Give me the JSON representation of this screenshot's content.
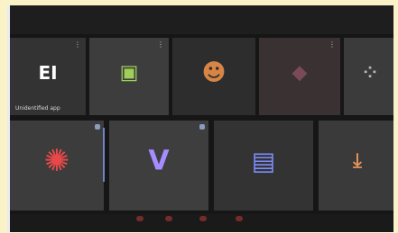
{
  "colors": {
    "background": "#fbf3c8",
    "panel": "#161616",
    "tile": "#3a3a3a",
    "accent": "#6e86c8"
  },
  "row1": [
    {
      "icon": "app-e-icon",
      "glyph": "EI",
      "label": "Unidentified app",
      "color": "#ffffff"
    },
    {
      "icon": "green-app-icon",
      "glyph": "▣",
      "label": "",
      "color": "#9fcf57"
    },
    {
      "icon": "character-avatar-icon",
      "glyph": "☻",
      "label": "",
      "color": "#d78545"
    },
    {
      "icon": "dark-app-icon",
      "glyph": "◆",
      "label": "",
      "color": "#7a4a5a"
    },
    {
      "icon": "dots-app-icon",
      "glyph": "⁘",
      "label": "",
      "color": "#bbbbbb"
    }
  ],
  "row2": [
    {
      "icon": "red-logo-icon",
      "glyph": "✺",
      "label": "",
      "color": "#e94848"
    },
    {
      "icon": "purple-v-icon",
      "glyph": "V",
      "label": "",
      "color": "#a58cff"
    },
    {
      "icon": "blue-app-icon",
      "glyph": "▤",
      "label": "",
      "color": "#7e8dff"
    },
    {
      "icon": "download-icon",
      "glyph": "⤓",
      "label": "",
      "color": "#e2915b"
    }
  ]
}
